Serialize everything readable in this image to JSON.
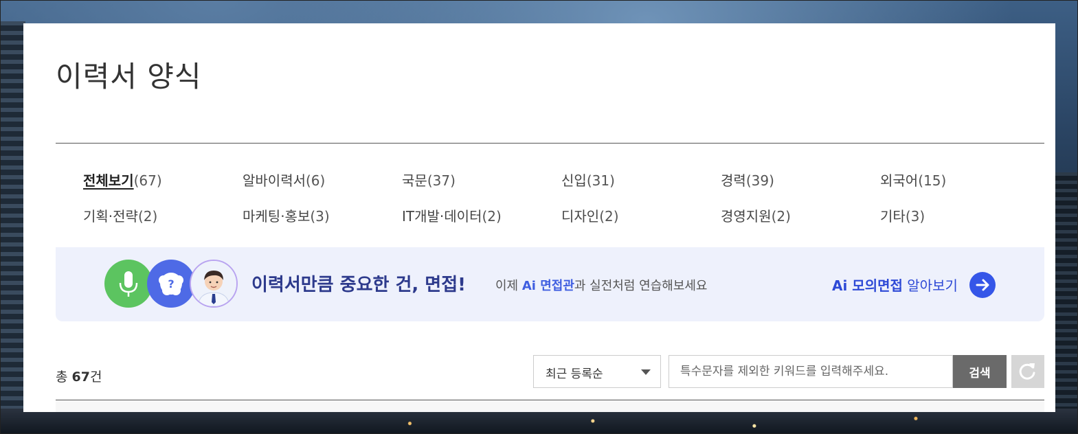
{
  "page": {
    "title": "이력서 양식"
  },
  "categories": [
    {
      "label": "전체보기",
      "count": "(67)",
      "active": true
    },
    {
      "label": "알바이력서",
      "count": "(6)"
    },
    {
      "label": "국문",
      "count": "(37)"
    },
    {
      "label": "신입",
      "count": "(31)"
    },
    {
      "label": "경력",
      "count": "(39)"
    },
    {
      "label": "외국어",
      "count": "(15)"
    },
    {
      "label": "기획·전략",
      "count": "(2)"
    },
    {
      "label": "마케팅·홍보",
      "count": "(3)"
    },
    {
      "label": "IT개발·데이터",
      "count": "(2)"
    },
    {
      "label": "디자인",
      "count": "(2)"
    },
    {
      "label": "경영지원",
      "count": "(2)"
    },
    {
      "label": "기타",
      "count": "(3)"
    }
  ],
  "banner": {
    "headline": "이력서만큼 중요한 건, 면접!",
    "sub_prefix": "이제 ",
    "sub_highlight": "Ai 면접관",
    "sub_suffix": "과 실전처럼 연습해보세요",
    "cta_bold": "Ai 모의면접",
    "cta_rest": " 알아보기",
    "icons": [
      "microphone-icon",
      "question-bubble-icon",
      "interviewer-avatar"
    ],
    "colors": {
      "bg": "#eef1fc",
      "accent": "#3556e8",
      "headline": "#2d3a8c",
      "mic": "#5cc460"
    }
  },
  "list_header": {
    "total_prefix": "총 ",
    "total_count": "67",
    "total_suffix": "건"
  },
  "sort": {
    "selected": "최근 등록순"
  },
  "search": {
    "placeholder": "특수문자를 제외한 키워드를 입력해주세요.",
    "value": "",
    "button_label": "검색"
  }
}
